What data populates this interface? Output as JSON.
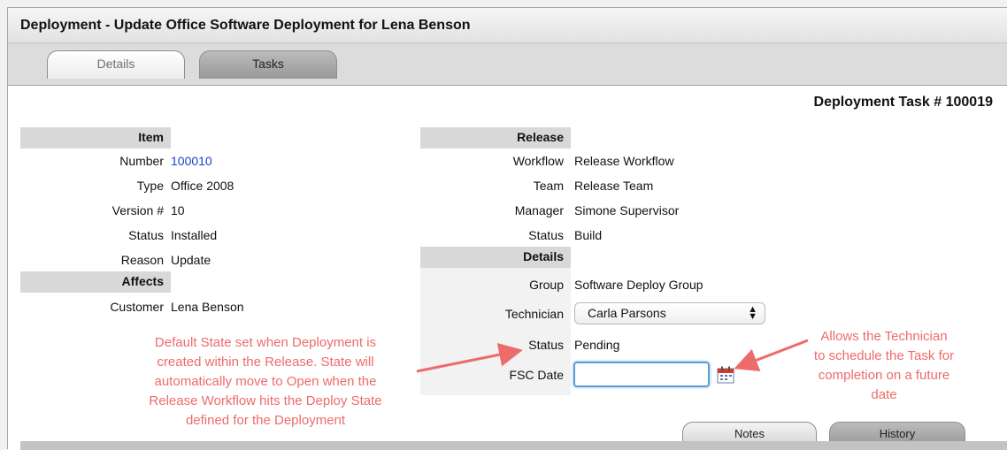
{
  "window": {
    "title": "Deployment - Update Office Software Deployment for Lena Benson"
  },
  "tabs": [
    {
      "label": "Details",
      "selected": false
    },
    {
      "label": "Tasks",
      "selected": true
    }
  ],
  "task_title": "Deployment Task # 100019",
  "item": {
    "header": "Item",
    "number_label": "Number",
    "number_value": "100010",
    "type_label": "Type",
    "type_value": "Office 2008",
    "version_label": "Version #",
    "version_value": "10",
    "status_label": "Status",
    "status_value": "Installed",
    "reason_label": "Reason",
    "reason_value": "Update"
  },
  "affects": {
    "header": "Affects",
    "customer_label": "Customer",
    "customer_value": "Lena Benson"
  },
  "release": {
    "header": "Release",
    "workflow_label": "Workflow",
    "workflow_value": "Release Workflow",
    "team_label": "Team",
    "team_value": "Release Team",
    "manager_label": "Manager",
    "manager_value": "Simone Supervisor",
    "status_label": "Status",
    "status_value": "Build"
  },
  "details": {
    "header": "Details",
    "group_label": "Group",
    "group_value": "Software Deploy Group",
    "technician_label": "Technician",
    "technician_value": "Carla Parsons",
    "status_label": "Status",
    "status_value": "Pending",
    "fsc_label": "FSC Date",
    "fsc_value": ""
  },
  "annotations": {
    "state": [
      "Default State set when Deployment is",
      "created within the Release. State will",
      "automatically move to Open when the",
      "Release Workflow hits the Deploy State",
      "defined for the Deployment"
    ],
    "technician": [
      "Allows the Technician",
      "to schedule the Task for",
      "completion on a future",
      "date"
    ],
    "color": "#ee6b6b"
  },
  "bottom_tabs": [
    {
      "label": "Notes"
    },
    {
      "label": "History"
    }
  ],
  "icons": {
    "calendar": "calendar-icon",
    "select_arrows": "chevron-updown-icon"
  }
}
